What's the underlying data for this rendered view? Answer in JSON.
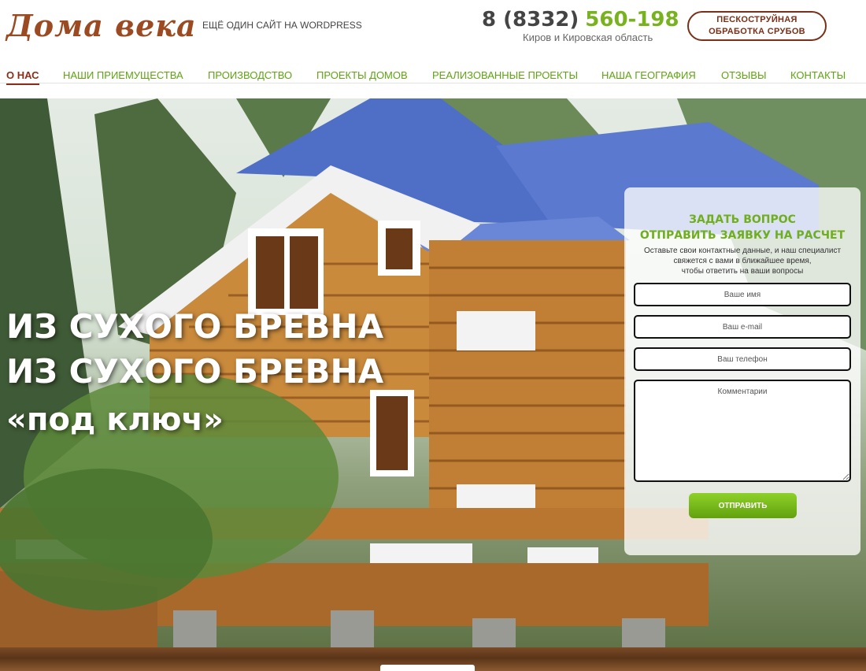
{
  "header": {
    "logo": "Дома века",
    "tagline": "ЕЩЁ ОДИН САЙТ НА WORDPRESS",
    "phone_prefix": "8 (8332)",
    "phone_number": "560-198",
    "region": "Киров и Кировская область",
    "cta_line1": "ПЕСКОСТРУЙНАЯ",
    "cta_line2": "ОБРАБОТКА СРУБОВ"
  },
  "nav": {
    "items": [
      {
        "label": "О НАС",
        "active": true
      },
      {
        "label": "НАШИ ПРИЕМУЩЕСТВА"
      },
      {
        "label": "ПРОИЗВОДСТВО"
      },
      {
        "label": "ПРОЕКТЫ ДОМОВ"
      },
      {
        "label": "РЕАЛИЗОВАННЫЕ ПРОЕКТЫ"
      },
      {
        "label": "НАША ГЕОГРАФИЯ"
      },
      {
        "label": "ОТЗЫВЫ"
      },
      {
        "label": "КОНТАКТЫ"
      }
    ]
  },
  "hero": {
    "line1": "ИЗ СУХОГО БРЕВНА",
    "line2": "ИЗ СУХОГО БРЕВНА",
    "line3": "«под ключ»"
  },
  "form": {
    "title1": "ЗАДАТЬ ВОПРОС",
    "title2": "ОТПРАВИТЬ ЗАЯВКУ НА РАСЧЕТ",
    "desc1": "Оставьте свои контактные данные, и наш специалист",
    "desc2": "свяжется с вами в ближайшее время,",
    "desc3": "чтобы ответить на ваши вопросы",
    "name_placeholder": "Ваше имя",
    "email_placeholder": "Ваш e-mail",
    "phone_placeholder": "Ваш телефон",
    "comment_placeholder": "Комментарии",
    "submit_label": "ОТПРАВИТЬ"
  },
  "colors": {
    "accent_green": "#78b21f",
    "brand_brown": "#8a2e1a"
  }
}
